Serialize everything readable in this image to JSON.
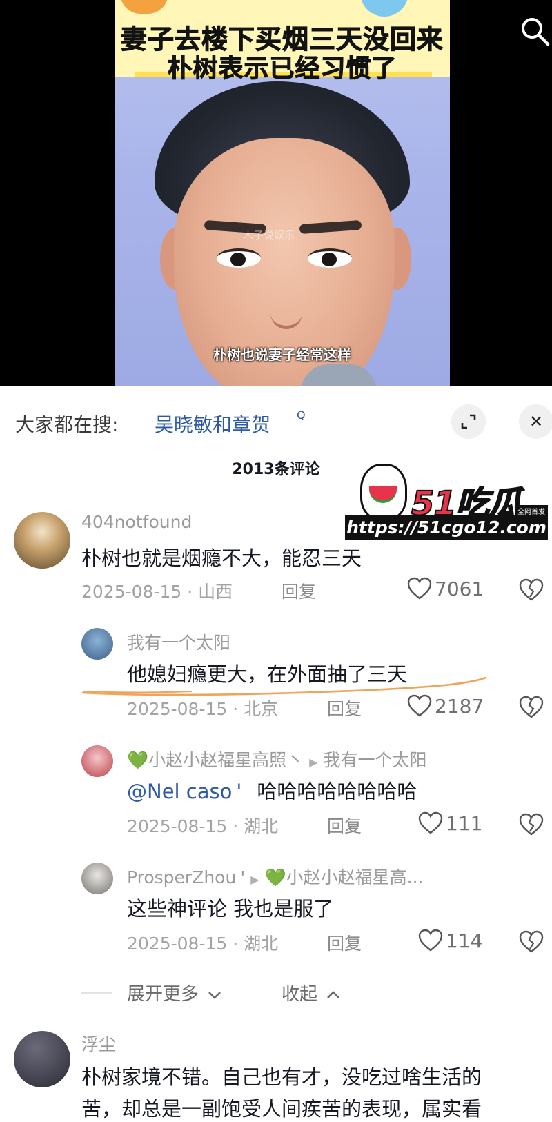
{
  "video": {
    "title_line1": "妻子去楼下买烟三天没回来",
    "title_line2": "朴树表示已经习惯了",
    "watermark": "木子说娱乐",
    "subtitle": "朴树也说妻子经常这样",
    "search_icon": "search-icon"
  },
  "search_bar": {
    "prefix": "大家都在搜:",
    "query": "吴晓敏和章贺",
    "query_icon": "Q",
    "expand_icon": "expand-icon",
    "close_icon": "close-icon",
    "close_glyph": "✕"
  },
  "comments_header": {
    "count_label": "2013条评论"
  },
  "site_logo": {
    "name": "51吃瓜",
    "badge": "全网首发",
    "url": "https://51cgo12.com"
  },
  "comments": [
    {
      "username": "404notfound",
      "content": "朴树也就是烟瘾不大，能忍三天",
      "date": "2025-08-15 · 山西",
      "reply_label": "回复",
      "likes": "7061",
      "replies": [
        {
          "username": "我有一个太阳",
          "content": "他媳妇瘾更大，在外面抽了三天",
          "date": "2025-08-15 · 北京",
          "reply_label": "回复",
          "likes": "2187"
        },
        {
          "username_heart": "💚",
          "username": "小赵小赵福星高照丶",
          "reply_to": "我有一个太阳",
          "mention": "@Nel caso",
          "mention_suffix": "'",
          "content": "哈哈哈哈哈哈哈哈",
          "date": "2025-08-15 · 湖北",
          "reply_label": "回复",
          "likes": "111"
        },
        {
          "username": "ProsperZhou",
          "username_suffix": "'",
          "reply_to_heart": "💚",
          "reply_to": "小赵小赵福星高...",
          "content": "这些神评论 我也是服了",
          "date": "2025-08-15 · 湖北",
          "reply_label": "回复",
          "likes": "114"
        }
      ],
      "expand_more_label": "展开更多",
      "collapse_label": "收起"
    },
    {
      "username": "浮尘",
      "content_line1": "朴树家境不错。自己也有才，没吃过啥生活的",
      "content_line2": "苦，却总是一副饱受人间疾苦的表现，属实看"
    }
  ],
  "colors": {
    "link_blue": "#2d5aa7",
    "annotation_orange": "#f0a35a",
    "logo_red": "#e8344a",
    "banner_yellow": "#fff6b8"
  }
}
